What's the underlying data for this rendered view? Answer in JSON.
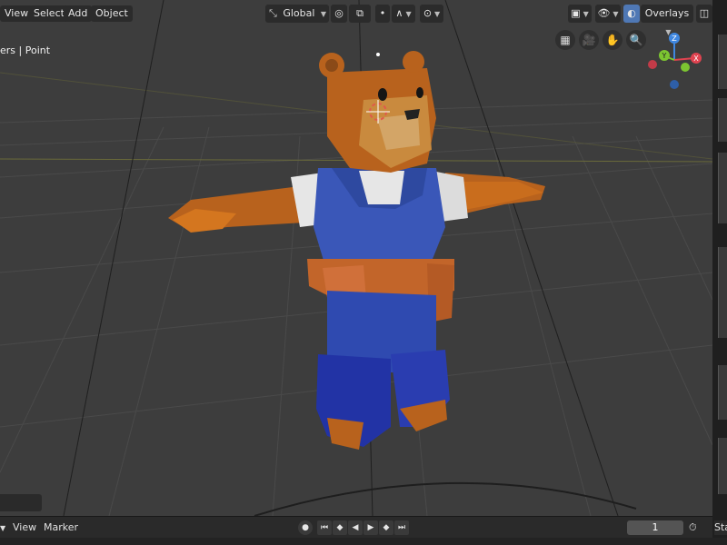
{
  "header": {
    "menus": [
      "View",
      "Select",
      "Add",
      "Object"
    ],
    "transform_orientation": "Global",
    "overlays_label": "Overlays"
  },
  "viewport": {
    "info_text": "ers | Point",
    "gizmo": {
      "z": "Z",
      "y": "Y",
      "x": "X"
    }
  },
  "timeline": {
    "view_label": "View",
    "marker_label": "Marker",
    "current_frame": "1",
    "start_label": "Sta"
  },
  "colors": {
    "viewport_bg": "#3d3d3d",
    "header_button": "#2b2b2b",
    "accent_blue": "#4f78b5",
    "axis_x": "#e04350",
    "axis_y": "#7cc531",
    "axis_z": "#3f87e0"
  },
  "icons": [
    "transform-pivot-icon",
    "snap-icon",
    "proportional-icon",
    "view-grid-icon",
    "camera-icon",
    "hand-pan-icon",
    "zoom-icon",
    "play-icon",
    "jump-start-icon",
    "jump-end-icon",
    "keyframe-prev-icon",
    "keyframe-next-icon",
    "stopwatch-icon"
  ]
}
